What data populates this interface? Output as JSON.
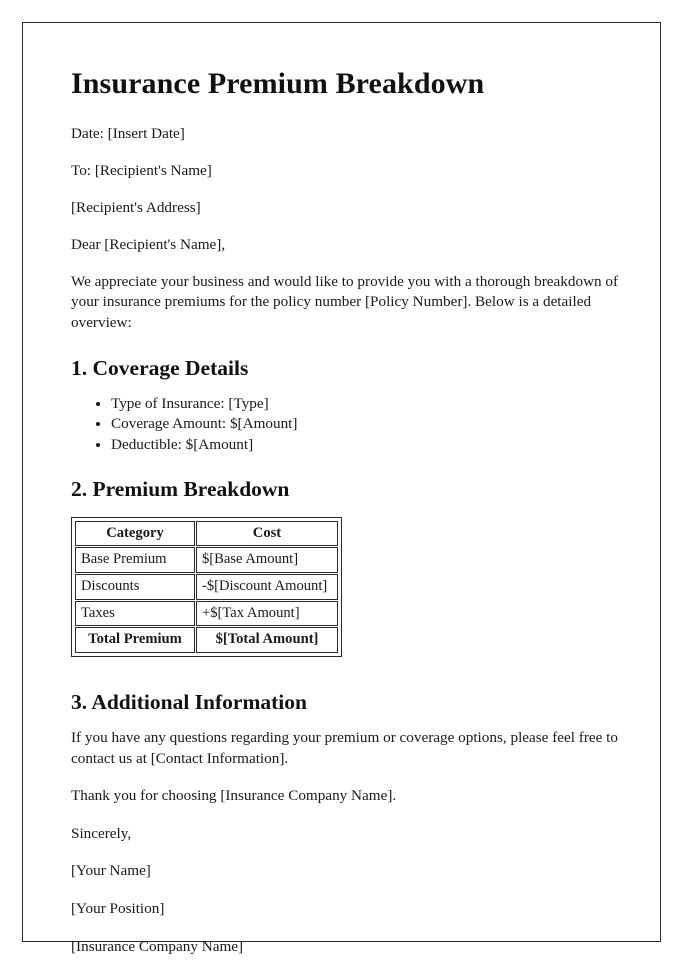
{
  "document": {
    "title": "Insurance Premium Breakdown",
    "date_line": "Date: [Insert Date]",
    "to_line": "To: [Recipient's Name]",
    "address_line": "[Recipient's Address]",
    "salutation": "Dear [Recipient's Name],",
    "intro_paragraph": "We appreciate your business and would like to provide you with a thorough breakdown of your insurance premiums for the policy number [Policy Number]. Below is a detailed overview:"
  },
  "coverage_section": {
    "heading": "1. Coverage Details",
    "items": [
      "Type of Insurance: [Type]",
      "Coverage Amount: $[Amount]",
      "Deductible: $[Amount]"
    ]
  },
  "premium_section": {
    "heading": "2. Premium Breakdown",
    "table": {
      "columns": [
        "Category",
        "Cost"
      ],
      "rows": [
        {
          "category": "Base Premium",
          "cost": "$[Base Amount]"
        },
        {
          "category": "Discounts",
          "cost": "-$[Discount Amount]"
        },
        {
          "category": "Taxes",
          "cost": "+$[Tax Amount]"
        }
      ],
      "total_row": {
        "category": "Total Premium",
        "cost": "$[Total Amount]"
      }
    }
  },
  "additional_section": {
    "heading": "3. Additional Information",
    "contact_paragraph": "If you have any questions regarding your premium or coverage options, please feel free to contact us at [Contact Information].",
    "thank_you": "Thank you for choosing [Insurance Company Name]."
  },
  "signature": {
    "closing": "Sincerely,",
    "name": "[Your Name]",
    "position": "[Your Position]",
    "company": "[Insurance Company Name]"
  }
}
